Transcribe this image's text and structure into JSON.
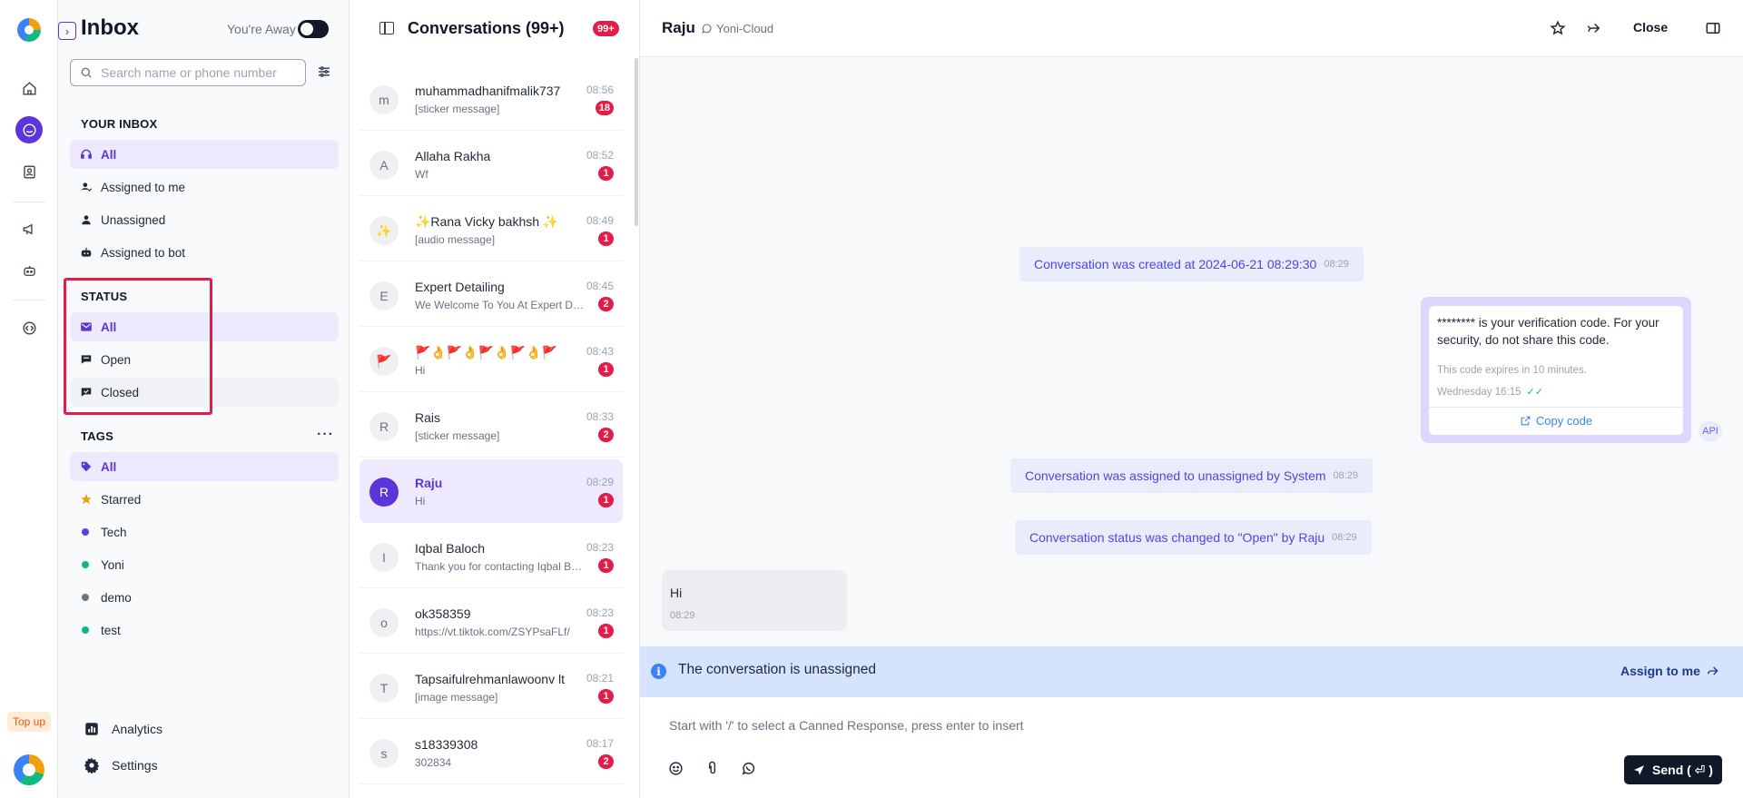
{
  "app": {
    "top_up_label": "Top up"
  },
  "rail": {
    "icons": [
      "home-icon",
      "chat-icon",
      "contacts-icon",
      "megaphone-icon",
      "bot-icon",
      "code-icon"
    ],
    "active_color": "#5b34da"
  },
  "sidebar": {
    "title": "Inbox",
    "away_label": "You're Away",
    "search_placeholder": "Search name or phone number",
    "your_inbox_heading": "YOUR INBOX",
    "inbox_items": [
      {
        "label": "All",
        "active": true
      },
      {
        "label": "Assigned to me"
      },
      {
        "label": "Unassigned"
      },
      {
        "label": "Assigned to bot"
      }
    ],
    "status_heading": "STATUS",
    "status_items": [
      {
        "label": "All",
        "active": true
      },
      {
        "label": "Open"
      },
      {
        "label": "Closed"
      }
    ],
    "tags_heading": "TAGS",
    "tag_items": [
      {
        "label": "All",
        "active": true
      },
      {
        "label": "Starred",
        "color": "#f59e0b"
      },
      {
        "label": "Tech",
        "color": "#4f46e5"
      },
      {
        "label": "Yoni",
        "color": "#10b981"
      },
      {
        "label": "demo",
        "color": "#6b7280"
      },
      {
        "label": "test",
        "color": "#10b981"
      }
    ],
    "analytics_label": "Analytics",
    "settings_label": "Settings"
  },
  "conversations": {
    "title": "Conversations (99+)",
    "badge": "99+",
    "items": [
      {
        "avatar": "m",
        "name": "muhammadhanifmalik737",
        "preview": "[sticker message]",
        "time": "08:56",
        "unread": "18"
      },
      {
        "avatar": "A",
        "name": "Allaha Rakha",
        "preview": "Wf",
        "time": "08:52",
        "unread": "1"
      },
      {
        "avatar": "✨",
        "name": "✨Rana Vicky bakhsh ✨",
        "preview": "[audio message]",
        "time": "08:49",
        "unread": "1"
      },
      {
        "avatar": "E",
        "name": "Expert Detailing",
        "preview": "We Welcome To You At Expert Detailing",
        "time": "08:45",
        "unread": "2"
      },
      {
        "avatar": "🚩",
        "name": "🚩👌🚩👌🚩👌🚩👌🚩",
        "preview": "Hi",
        "time": "08:43",
        "unread": "1"
      },
      {
        "avatar": "R",
        "name": "Rais",
        "preview": "[sticker message]",
        "time": "08:33",
        "unread": "2"
      },
      {
        "avatar": "R",
        "name": "Raju",
        "preview": "Hi",
        "time": "08:29",
        "unread": "1",
        "selected": true
      },
      {
        "avatar": "I",
        "name": "Iqbal Baloch",
        "preview": "Thank you for contacting Iqbal Baloch",
        "time": "08:23",
        "unread": "1"
      },
      {
        "avatar": "o",
        "name": "ok358359",
        "preview": "https://vt.tiktok.com/ZSYPsaFLf/",
        "time": "08:23",
        "unread": "1"
      },
      {
        "avatar": "T",
        "name": "Tapsaifulrehmanlawoonv lt",
        "preview": "[image message]",
        "time": "08:21",
        "unread": "1"
      },
      {
        "avatar": "s",
        "name": "s18339308",
        "preview": "302834",
        "time": "08:17",
        "unread": "2"
      }
    ]
  },
  "chat": {
    "contact_name": "Raju",
    "channel": "Yoni-Cloud",
    "close_label": "Close",
    "system_messages": [
      {
        "text": "Conversation was created at 2024-06-21 08:29:30",
        "time": "08:29"
      },
      {
        "text": "Conversation was assigned to unassigned by System",
        "time": "08:29"
      },
      {
        "text": "Conversation status was changed to \"Open\" by Raju",
        "time": "08:29"
      }
    ],
    "template": {
      "body": "******** is your verification code. For your security, do not share this code.",
      "footer": "This code expires in 10 minutes.",
      "stamp": "Wednesday 16:15",
      "copy_label": "Copy code",
      "sender_tag": "API"
    },
    "incoming": {
      "text": "Hi",
      "time": "08:29"
    },
    "banner_text": "The conversation is unassigned",
    "assign_label": "Assign to me",
    "composer_placeholder": "Start with '/' to select a Canned Response, press enter to insert",
    "send_label": "Send ( ⏎ )"
  }
}
